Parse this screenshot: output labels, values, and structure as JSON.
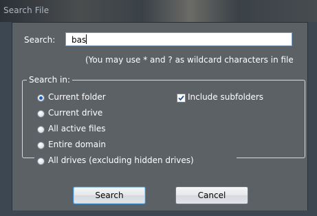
{
  "window": {
    "title": "Search File"
  },
  "search": {
    "label": "Search:",
    "value": "bas",
    "hint": "(You may use * and ? as wildcard characters in file"
  },
  "search_in": {
    "legend": "Search in:",
    "options": [
      {
        "label": "Current folder",
        "selected": true
      },
      {
        "label": "Current drive",
        "selected": false
      },
      {
        "label": "All active files",
        "selected": false
      },
      {
        "label": "Entire domain",
        "selected": false
      },
      {
        "label": "All drives (excluding hidden drives)",
        "selected": false
      }
    ],
    "include_subfolders": {
      "label": "Include subfolders",
      "checked": true
    }
  },
  "buttons": {
    "search": "Search",
    "cancel": "Cancel"
  }
}
